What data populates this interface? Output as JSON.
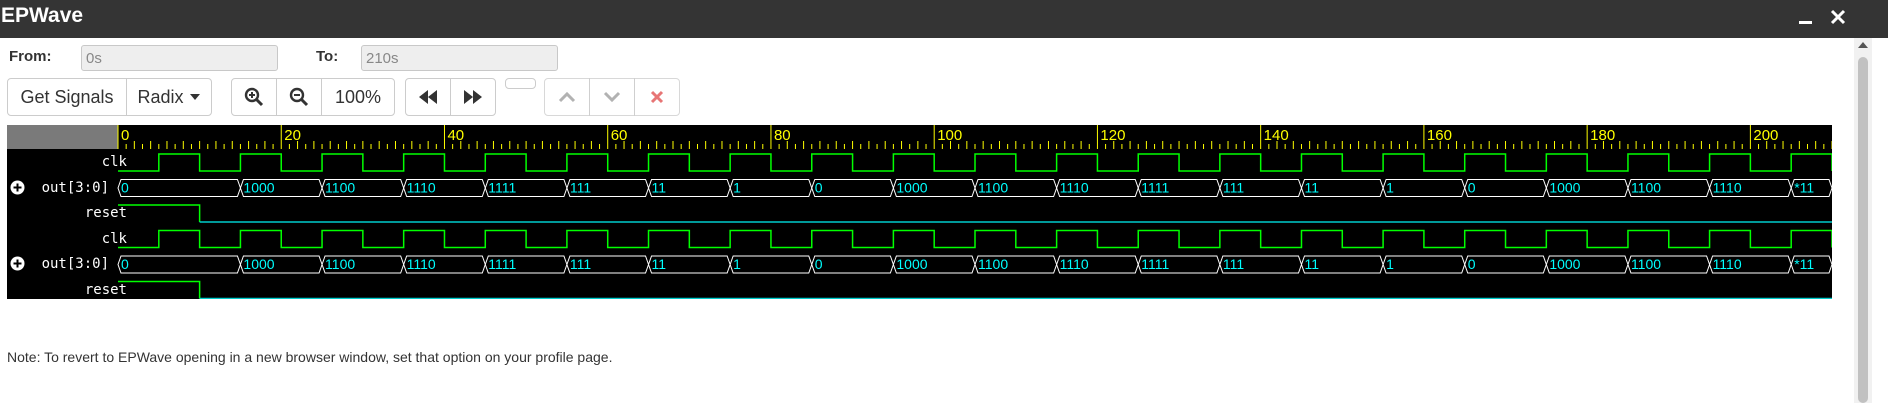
{
  "window": {
    "title": "EPWave"
  },
  "range": {
    "from_label": "From:",
    "from_value": "0s",
    "to_label": "To:",
    "to_value": "210s"
  },
  "toolbar": {
    "get_signals_label": "Get Signals",
    "radix_label": "Radix",
    "zoom_level": "100%"
  },
  "ruler": {
    "ticks": [
      "0",
      "20",
      "40",
      "60",
      "80",
      "100",
      "120",
      "140",
      "160",
      "180",
      "200"
    ],
    "start": 0,
    "end": 210
  },
  "signals": [
    {
      "name": "clk",
      "kind": "clock",
      "expandable": false,
      "period": 10,
      "first_rise": 5
    },
    {
      "name": "out[3:0]",
      "kind": "bus",
      "expandable": true,
      "segments": [
        {
          "start": 0,
          "end": 15,
          "label": "0"
        },
        {
          "start": 15,
          "end": 25,
          "label": "1000"
        },
        {
          "start": 25,
          "end": 35,
          "label": "1100"
        },
        {
          "start": 35,
          "end": 45,
          "label": "1110"
        },
        {
          "start": 45,
          "end": 55,
          "label": "1111"
        },
        {
          "start": 55,
          "end": 65,
          "label": "111"
        },
        {
          "start": 65,
          "end": 75,
          "label": "11"
        },
        {
          "start": 75,
          "end": 85,
          "label": "1"
        },
        {
          "start": 85,
          "end": 95,
          "label": "0"
        },
        {
          "start": 95,
          "end": 105,
          "label": "1000"
        },
        {
          "start": 105,
          "end": 115,
          "label": "1100"
        },
        {
          "start": 115,
          "end": 125,
          "label": "1110"
        },
        {
          "start": 125,
          "end": 135,
          "label": "1111"
        },
        {
          "start": 135,
          "end": 145,
          "label": "111"
        },
        {
          "start": 145,
          "end": 155,
          "label": "11"
        },
        {
          "start": 155,
          "end": 165,
          "label": "1"
        },
        {
          "start": 165,
          "end": 175,
          "label": "0"
        },
        {
          "start": 175,
          "end": 185,
          "label": "1000"
        },
        {
          "start": 185,
          "end": 195,
          "label": "1100"
        },
        {
          "start": 195,
          "end": 205,
          "label": "1110"
        },
        {
          "start": 205,
          "end": 210,
          "label": "*11"
        }
      ]
    },
    {
      "name": "reset",
      "kind": "bit",
      "expandable": false,
      "high_until": 10
    },
    {
      "name": "clk",
      "kind": "clock",
      "expandable": false,
      "period": 10,
      "first_rise": 5
    },
    {
      "name": "out[3:0]",
      "kind": "bus",
      "expandable": true,
      "segments": [
        {
          "start": 0,
          "end": 15,
          "label": "0"
        },
        {
          "start": 15,
          "end": 25,
          "label": "1000"
        },
        {
          "start": 25,
          "end": 35,
          "label": "1100"
        },
        {
          "start": 35,
          "end": 45,
          "label": "1110"
        },
        {
          "start": 45,
          "end": 55,
          "label": "1111"
        },
        {
          "start": 55,
          "end": 65,
          "label": "111"
        },
        {
          "start": 65,
          "end": 75,
          "label": "11"
        },
        {
          "start": 75,
          "end": 85,
          "label": "1"
        },
        {
          "start": 85,
          "end": 95,
          "label": "0"
        },
        {
          "start": 95,
          "end": 105,
          "label": "1000"
        },
        {
          "start": 105,
          "end": 115,
          "label": "1100"
        },
        {
          "start": 115,
          "end": 125,
          "label": "1110"
        },
        {
          "start": 125,
          "end": 135,
          "label": "1111"
        },
        {
          "start": 135,
          "end": 145,
          "label": "111"
        },
        {
          "start": 145,
          "end": 155,
          "label": "11"
        },
        {
          "start": 155,
          "end": 165,
          "label": "1"
        },
        {
          "start": 165,
          "end": 175,
          "label": "0"
        },
        {
          "start": 175,
          "end": 185,
          "label": "1000"
        },
        {
          "start": 185,
          "end": 195,
          "label": "1100"
        },
        {
          "start": 195,
          "end": 205,
          "label": "1110"
        },
        {
          "start": 205,
          "end": 210,
          "label": "*11"
        }
      ]
    },
    {
      "name": "reset",
      "kind": "bit",
      "expandable": false,
      "high_until": 10
    }
  ],
  "note": "Note: To revert to EPWave opening in a new browser window, set that option on your profile page.",
  "colors": {
    "titlebar": "#343434",
    "wave_bg": "#000000",
    "ruler_bg": "#7a7a7a",
    "ruler_text": "#ffff00",
    "clock_high": "#00ff00",
    "clock_low": "#00cccc",
    "bus_value": "#00ffff",
    "bus_outline": "#ffffff",
    "reset_high": "#00ff00",
    "reset_low": "#00cccc"
  }
}
